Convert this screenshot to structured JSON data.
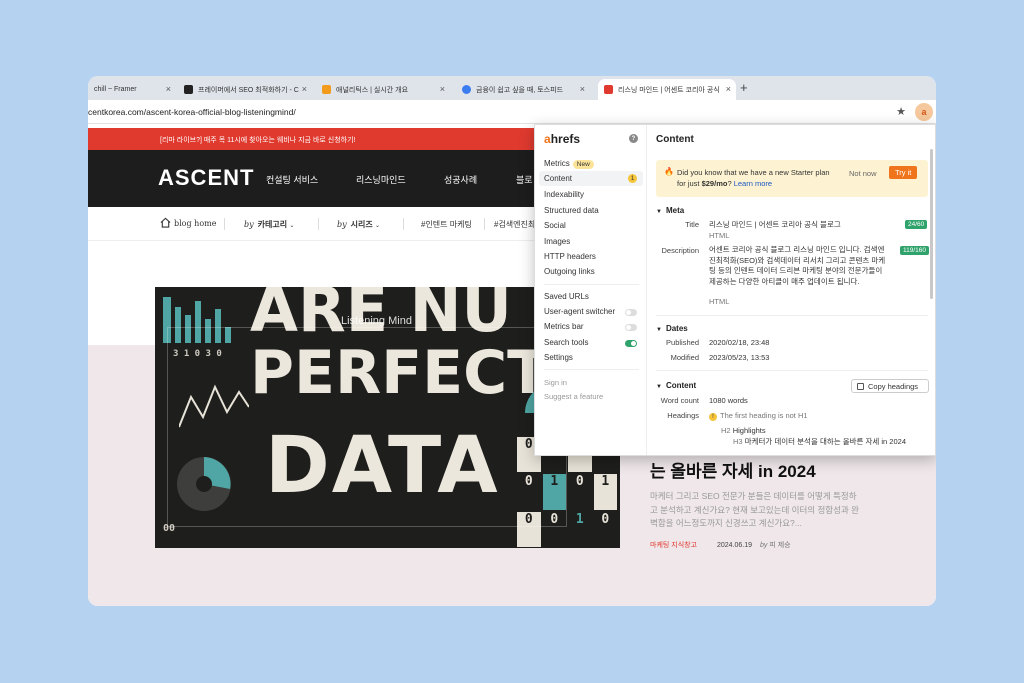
{
  "browser": {
    "tabs": [
      {
        "label": "chill ~ Framer"
      },
      {
        "label": "프레이머에서 SEO 최적화하기 - C"
      },
      {
        "label": "애널리틱스 | 실시간 개요"
      },
      {
        "label": "금융이 쉽고 싶을 때, 토스피드"
      },
      {
        "label": "리스닝 마인드 | 어센트 코리아 공식"
      }
    ],
    "url": "centkorea.com/ascent-korea-official-blog-listeningmind/",
    "ext_letter": "a"
  },
  "site": {
    "banner": "[리마 라이브?] 매주 목 11시에 찾아오는 웨비나 지금 바로 신청하기!",
    "logo": "ASCENT",
    "nav": [
      "컨설팅 서비스",
      "리스닝마인드",
      "성공사례",
      "블로"
    ],
    "subnav": {
      "home": "blog home",
      "by": "by",
      "category": "카테고리",
      "series": "시리즈",
      "tag1": "#인텐트 마케팅",
      "tag2": "#검색엔진최"
    },
    "hero": {
      "line1": "ARE NU",
      "line2": "PERFECT",
      "line3": "DATA",
      "overlay": "Listening Mind"
    },
    "post": {
      "title": "는 올바른 자세 in 2024",
      "desc": "마케터 그리고 SEO 전문가 분들은 데이터를 어떻게 특정하고 분석하고 계신가요? 현재 보고있는데 이터의 정합성과 완벽함을 어느정도까지 신경쓰고 계신가요?...",
      "category": "마케팅 지식창고",
      "date": "2024.06.19",
      "by": "by",
      "author": "피 제승"
    }
  },
  "ahrefs": {
    "logo_a": "a",
    "logo_rest": "hrefs",
    "menu": {
      "metrics": "Metrics",
      "new_badge": "New",
      "content": "Content",
      "content_count": "1",
      "indexability": "Indexability",
      "structured": "Structured data",
      "social": "Social",
      "images": "Images",
      "http": "HTTP headers",
      "outgoing": "Outgoing links",
      "saved": "Saved URLs",
      "ua": "User-agent switcher",
      "metrics_bar": "Metrics bar",
      "search_tools": "Search tools",
      "settings": "Settings",
      "signin": "Sign in",
      "suggest": "Suggest a feature"
    },
    "panel": {
      "title": "Content",
      "notice_text": "Did you know that we have a new Starter plan for just ",
      "notice_price": "$29/mo",
      "notice_q": "?",
      "notice_link": "Learn more",
      "not_now": "Not now",
      "try_it": "Try it",
      "meta_head": "Meta",
      "title_label": "Title",
      "title_value": "리스닝 마인드 | 어센트 코리아 공식 블로그",
      "title_type": "HTML",
      "title_count": "24/60",
      "desc_label": "Description",
      "desc_value": "어센트 코리아 공식 블로그 리스닝 마인드 입니다. 검색엔진최적화(SEO)와 검색데이터 리서치 그리고 콘텐츠 마케팅 등의 인텐트 데이터 드리븐 마케팅 분야의 전문가들이 제공하는 다양한 아티클이 매주 업데이트 됩니다.",
      "desc_type": "HTML",
      "desc_count": "119/160",
      "dates_head": "Dates",
      "published_label": "Published",
      "published_value": "2020/02/18, 23:48",
      "modified_label": "Modified",
      "modified_value": "2023/05/23, 13:53",
      "content_head": "Content",
      "copy_headings": "Copy headings",
      "wordcount_label": "Word count",
      "wordcount_value": "1080 words",
      "headings_label": "Headings",
      "headings_warning": "The first heading is not H1",
      "h2": "H2",
      "h2_text": "Highlights",
      "h3": "H3",
      "h3_text": "마케터가 데이터 분석을 대하는 올바른 자세 in 2024"
    }
  }
}
